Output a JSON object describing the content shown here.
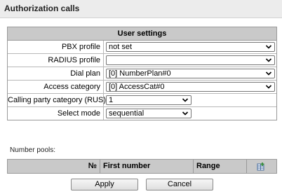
{
  "window": {
    "title": "Authorization calls"
  },
  "settings": {
    "header": "User settings",
    "rows": [
      {
        "label": "PBX profile",
        "value": "not set"
      },
      {
        "label": "RADIUS profile",
        "value": ""
      },
      {
        "label": "Dial plan",
        "value": "[0] NumberPlan#0"
      },
      {
        "label": "Access category",
        "value": "[0] AccessCat#0"
      },
      {
        "label": "Calling party category (RUS)",
        "value": "1"
      },
      {
        "label": "Select mode",
        "value": "sequential"
      }
    ]
  },
  "number_pools": {
    "label": "Number pools:",
    "columns": [
      "№",
      "First number",
      "Range"
    ],
    "add_icon": "add-row-icon"
  },
  "buttons": {
    "apply": "Apply",
    "cancel": "Cancel"
  }
}
